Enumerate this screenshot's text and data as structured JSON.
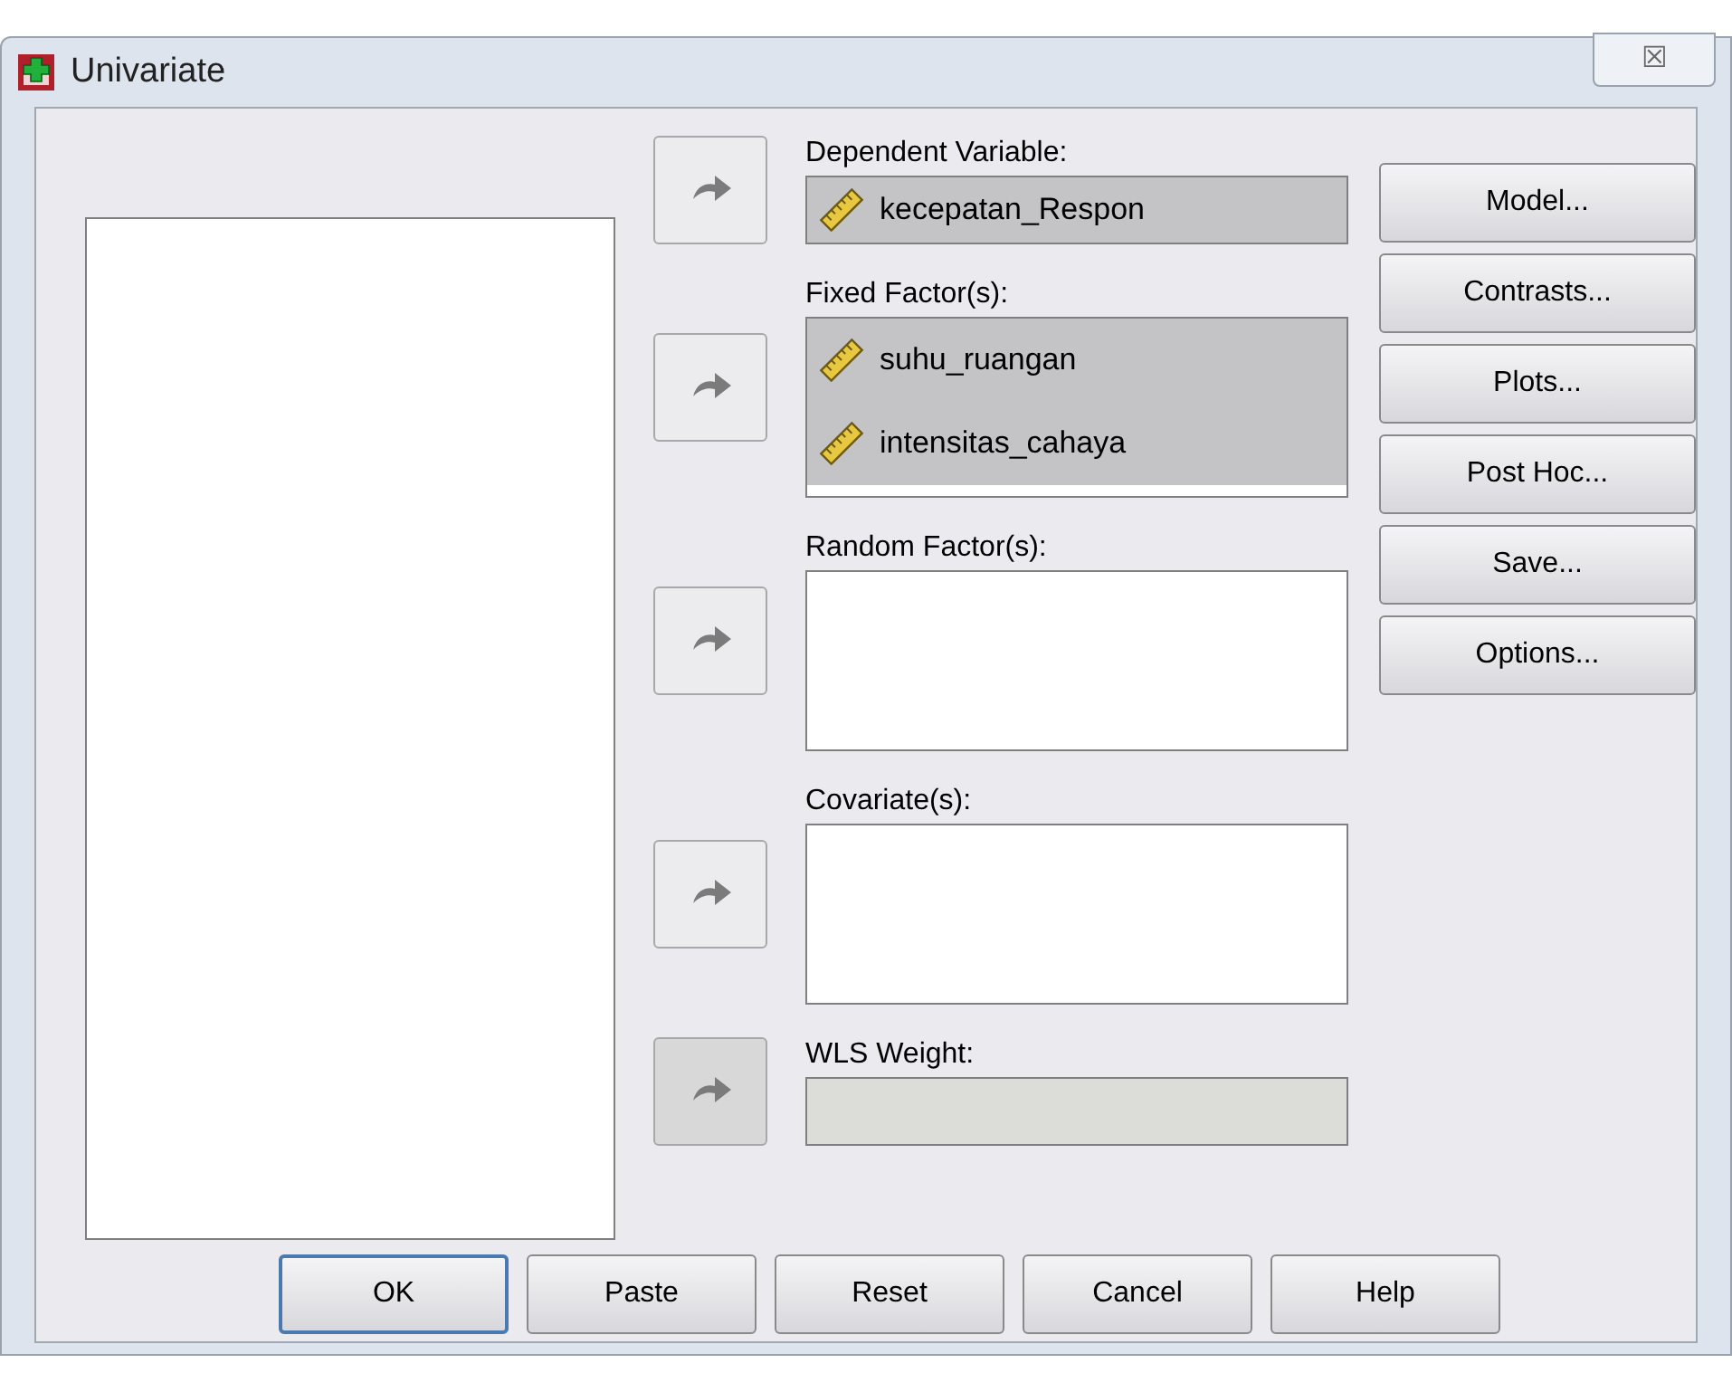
{
  "window": {
    "title": "Univariate",
    "close": "☒"
  },
  "target_lists": [
    {
      "label": "Dependent Variable:",
      "kind": "single",
      "disabled": false,
      "items": [
        {
          "name": "kecepatan_Respon",
          "selected": true
        }
      ]
    },
    {
      "label": "Fixed Factor(s):",
      "kind": "list",
      "disabled": false,
      "items": [
        {
          "name": "suhu_ruangan",
          "selected": true
        },
        {
          "name": "intensitas_cahaya",
          "selected": true
        }
      ]
    },
    {
      "label": "Random Factor(s):",
      "kind": "list",
      "disabled": false
    },
    {
      "label": "Covariate(s):",
      "kind": "list",
      "disabled": false
    },
    {
      "label": "WLS Weight:",
      "kind": "single",
      "disabled": true
    }
  ],
  "side_buttons": [
    "Model...",
    "Contrasts...",
    "Plots...",
    "Post Hoc...",
    "Save...",
    "Options..."
  ],
  "bottom_buttons": [
    {
      "label": "OK",
      "default": true
    },
    {
      "label": "Paste",
      "default": false
    },
    {
      "label": "Reset",
      "default": false
    },
    {
      "label": "Cancel",
      "default": false
    },
    {
      "label": "Help",
      "default": false
    }
  ]
}
